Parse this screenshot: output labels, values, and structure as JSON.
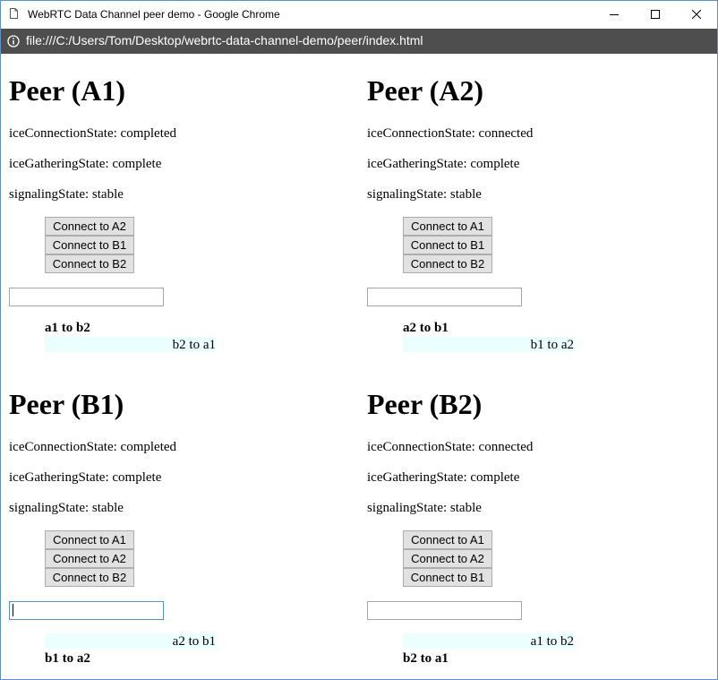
{
  "window": {
    "title": "WebRTC Data Channel peer demo - Google Chrome",
    "url": "file:///C:/Users/Tom/Desktop/webrtc-data-channel-demo/peer/index.html"
  },
  "colors": {
    "address_bar": "#4e4e4e",
    "received_message_bg": "#ebfffe",
    "button_bg": "#e1e1e1",
    "window_border": "#5a8fd1"
  },
  "peers": [
    {
      "title": "Peer (A1)",
      "ice_connection": "iceConnectionState: completed",
      "ice_gathering": "iceGatheringState: complete",
      "signaling": "signalingState: stable",
      "buttons": [
        "Connect to A2",
        "Connect to B1",
        "Connect to B2"
      ],
      "input_value": "",
      "sent_message": "a1 to b2",
      "received_message": "b2 to a1"
    },
    {
      "title": "Peer (A2)",
      "ice_connection": "iceConnectionState: connected",
      "ice_gathering": "iceGatheringState: complete",
      "signaling": "signalingState: stable",
      "buttons": [
        "Connect to A1",
        "Connect to B1",
        "Connect to B2"
      ],
      "input_value": "",
      "sent_message": "a2 to b1",
      "received_message": "b1 to a2"
    },
    {
      "title": "Peer (B1)",
      "ice_connection": "iceConnectionState: completed",
      "ice_gathering": "iceGatheringState: complete",
      "signaling": "signalingState: stable",
      "buttons": [
        "Connect to A1",
        "Connect to A2",
        "Connect to B2"
      ],
      "input_value": "",
      "sent_message": "b1 to a2",
      "received_message": "a2 to b1"
    },
    {
      "title": "Peer (B2)",
      "ice_connection": "iceConnectionState: connected",
      "ice_gathering": "iceGatheringState: complete",
      "signaling": "signalingState: stable",
      "buttons": [
        "Connect to A1",
        "Connect to A2",
        "Connect to B1"
      ],
      "input_value": "",
      "sent_message": "b2 to a1",
      "received_message": "a1 to b2"
    }
  ]
}
